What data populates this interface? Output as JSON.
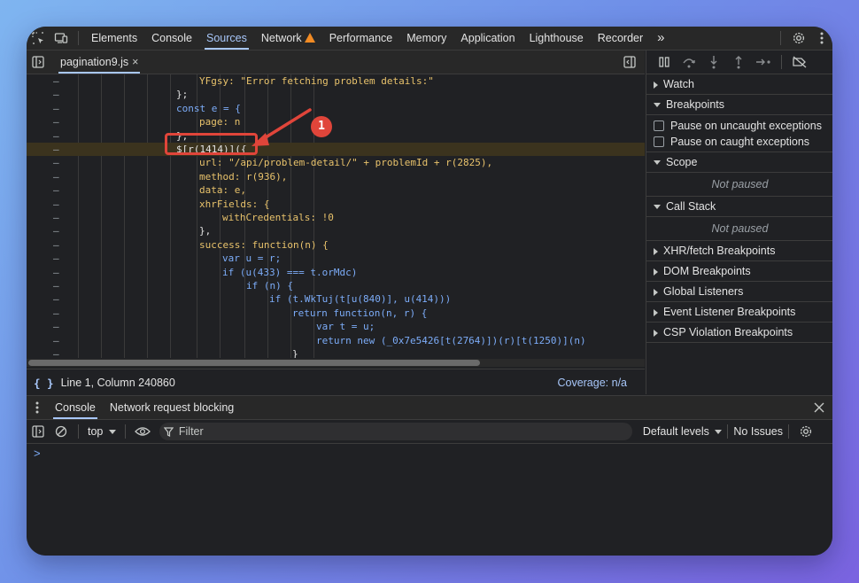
{
  "toolbar": {
    "tabs": [
      "Elements",
      "Console",
      "Sources",
      "Network",
      "Performance",
      "Memory",
      "Application",
      "Lighthouse",
      "Recorder"
    ],
    "active_tab": "Sources",
    "more": "»"
  },
  "editor": {
    "file_tab": "pagination9.js",
    "close": "×",
    "lines": [
      "YFgsy: \"Error fetching problem details:\"",
      "};",
      "const e = {",
      "page: n",
      "};",
      "$[r(1414)]({",
      "url: \"/api/problem-detail/\" + problemId + r(2825),",
      "method: r(936),",
      "data: e,",
      "xhrFields: {",
      "withCredentials: !0",
      "},",
      "success: function(n) {",
      "var u = r;",
      "if (u(433) === t.orMdc)",
      "if (n) {",
      "if (t.WkTuj(t[u(840)], u(414)))",
      "return function(n, r) {",
      "var t = u;",
      "return new (_0x7e5426[t(2764)])(r)[t(1250)](n)",
      "}"
    ],
    "gutter_mark": "–",
    "annotation_number": "1",
    "status_position": "Line 1, Column 240860",
    "coverage": "Coverage: n/a",
    "braces": "{ }"
  },
  "debugger": {
    "sections": {
      "watch": "Watch",
      "breakpoints": "Breakpoints",
      "pause_uncaught": "Pause on uncaught exceptions",
      "pause_caught": "Pause on caught exceptions",
      "scope": "Scope",
      "scope_state": "Not paused",
      "call_stack": "Call Stack",
      "call_stack_state": "Not paused",
      "xhr": "XHR/fetch Breakpoints",
      "dom": "DOM Breakpoints",
      "global": "Global Listeners",
      "event": "Event Listener Breakpoints",
      "csp": "CSP Violation Breakpoints"
    }
  },
  "drawer": {
    "tabs": [
      "Console",
      "Network request blocking"
    ],
    "context": "top",
    "filter_placeholder": "Filter",
    "levels": "Default levels",
    "issues": "No Issues",
    "prompt": ">"
  }
}
